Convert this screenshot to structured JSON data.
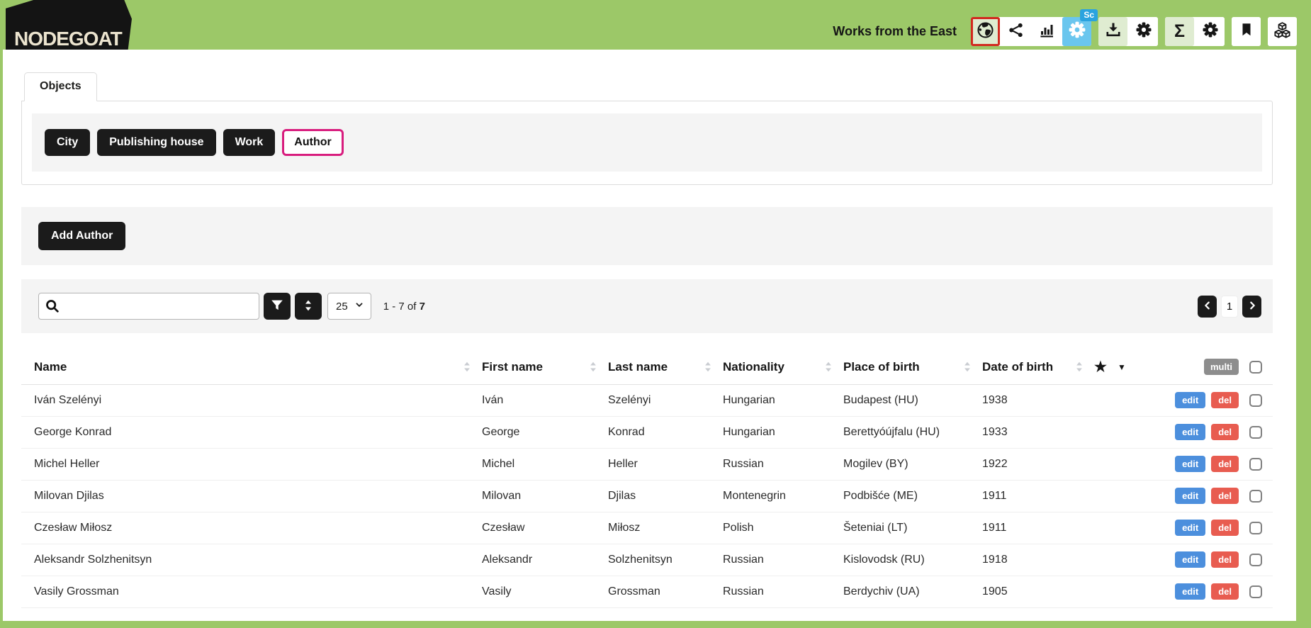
{
  "header": {
    "logo": "NODEGOAT",
    "project_title": "Works from the East",
    "badge": "Sc"
  },
  "icons": {
    "sigma": "Σ",
    "star": "★",
    "caret": "▼"
  },
  "tabs": {
    "objects": "Objects"
  },
  "object_types": [
    {
      "label": "City"
    },
    {
      "label": "Publishing house"
    },
    {
      "label": "Work"
    },
    {
      "label": "Author"
    }
  ],
  "actions": {
    "add": "Add Author"
  },
  "search": {
    "placeholder": "",
    "value": "",
    "page_size": "25",
    "count_prefix": "1 - 7 of",
    "count_total": "7"
  },
  "pagination": {
    "current": "1"
  },
  "table": {
    "columns": [
      "Name",
      "First name",
      "Last name",
      "Nationality",
      "Place of birth",
      "Date of birth"
    ],
    "multi_label": "multi",
    "edit_label": "edit",
    "del_label": "del",
    "rows": [
      {
        "name": "Iván Szelényi",
        "first": "Iván",
        "last": "Szelényi",
        "nationality": "Hungarian",
        "place": "Budapest (HU)",
        "dob": "1938"
      },
      {
        "name": "George Konrad",
        "first": "George",
        "last": "Konrad",
        "nationality": "Hungarian",
        "place": "Berettyóújfalu (HU)",
        "dob": "1933"
      },
      {
        "name": "Michel Heller",
        "first": "Michel",
        "last": "Heller",
        "nationality": "Russian",
        "place": "Mogilev (BY)",
        "dob": "1922"
      },
      {
        "name": "Milovan Djilas",
        "first": "Milovan",
        "last": "Djilas",
        "nationality": "Montenegrin",
        "place": "Podbišće (ME)",
        "dob": "1911"
      },
      {
        "name": "Czesław Miłosz",
        "first": "Czesław",
        "last": "Miłosz",
        "nationality": "Polish",
        "place": "Šeteniai (LT)",
        "dob": "1911"
      },
      {
        "name": "Aleksandr Solzhenitsyn",
        "first": "Aleksandr",
        "last": "Solzhenitsyn",
        "nationality": "Russian",
        "place": "Kislovodsk (RU)",
        "dob": "1918"
      },
      {
        "name": "Vasily Grossman",
        "first": "Vasily",
        "last": "Grossman",
        "nationality": "Russian",
        "place": "Berdychiv (UA)",
        "dob": "1905"
      }
    ]
  },
  "colors": {
    "band_green": "#9cc868",
    "tile_green": "#dfecd1",
    "scope_blue": "#6ac6ee",
    "badge_blue": "#2aa3df",
    "highlight_red": "#d22b20",
    "highlight_pink": "#d81d7e",
    "edit_blue": "#4c8fdd",
    "del_red": "#e85c50",
    "multi_gray": "#8d8d8d",
    "dark_button": "#1b1b1b"
  }
}
